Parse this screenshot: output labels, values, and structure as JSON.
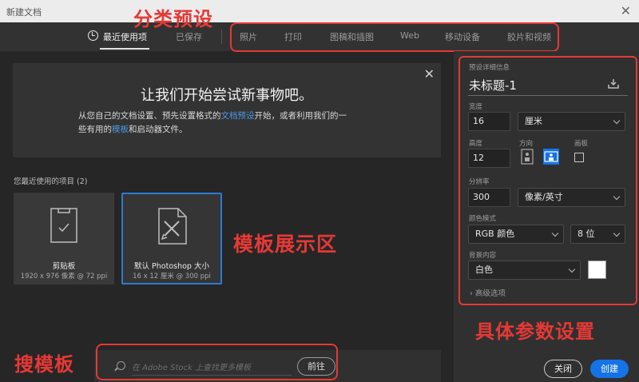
{
  "window": {
    "title": "新建文档",
    "close": "✕"
  },
  "tabs": {
    "recent": "最近使用项",
    "saved": "已保存",
    "presets": [
      "照片",
      "打印",
      "图稿和插图",
      "Web",
      "移动设备",
      "胶片和视频"
    ]
  },
  "annotations": {
    "category_presets": "分类预设",
    "template_area": "模板展示区",
    "search_template": "搜模板",
    "detail_settings": "具体参数设置"
  },
  "banner": {
    "title": "让我们开始尝试新事物吧。",
    "line1_pre": "从您自己的文档设置、预先设置格式的",
    "link1": "文档预设",
    "line1_post": "开始，或者利用我们的一",
    "line2_pre": "些有用的",
    "link2": "模板",
    "line2_post": "和启动器文件。",
    "close": "✕"
  },
  "recent": {
    "label": "您最近使用的项目 (2)",
    "items": [
      {
        "name": "剪贴板",
        "size": "1920 x 976 像素 @ 72 ppi"
      },
      {
        "name": "默认 Photoshop 大小",
        "size": "16 x 12 厘米 @ 300 ppi"
      }
    ]
  },
  "stock": {
    "placeholder": "在 Adobe Stock 上查找更多模板",
    "go": "前往"
  },
  "details": {
    "header": "预设详细信息",
    "doc_name": "未标题-1",
    "width_label": "宽度",
    "width_value": "16",
    "width_unit": "厘米",
    "height_label": "高度",
    "height_value": "12",
    "orientation_label": "方向",
    "artboard_label": "画板",
    "resolution_label": "分辨率",
    "resolution_value": "300",
    "resolution_unit": "像素/英寸",
    "color_mode_label": "颜色模式",
    "color_mode_value": "RGB 颜色",
    "bit_depth": "8 位",
    "background_label": "背景内容",
    "background_value": "白色",
    "advanced": "高级选项",
    "close_button": "关闭",
    "create_button": "创建"
  },
  "colors": {
    "accent": "#1473e6",
    "annotation": "#e53935",
    "link": "#4a9be8"
  }
}
